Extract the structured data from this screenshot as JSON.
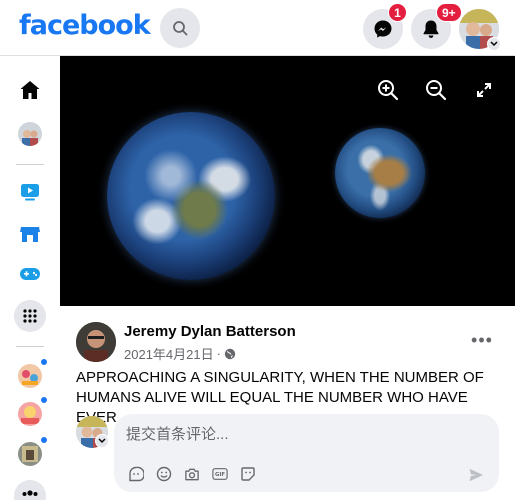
{
  "header": {
    "logo_text": "facebook",
    "messenger_badge": "1",
    "notifications_badge": "9+"
  },
  "post": {
    "author": "Jeremy Dylan Batterson",
    "date": "2021年4月21日",
    "date_separator": "·",
    "text": "APPROACHING A SINGULARITY, WHEN THE NUMBER OF HUMANS ALIVE WILL EQUAL THE NUMBER WHO HAVE EVER",
    "more_label": "•••"
  },
  "comment": {
    "placeholder": "提交首条评论...",
    "gif_label": "GIF"
  },
  "colors": {
    "brand": "#1877f2",
    "badge": "#e41e3f"
  }
}
